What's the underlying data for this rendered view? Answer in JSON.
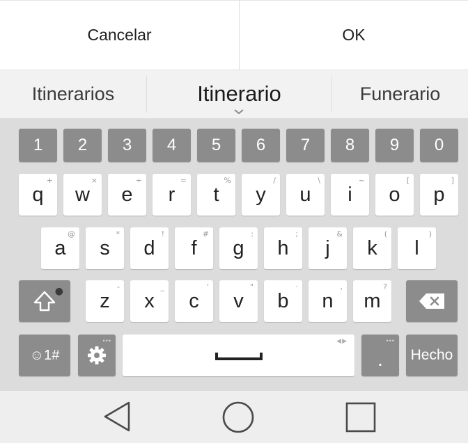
{
  "dialog": {
    "cancel_label": "Cancelar",
    "ok_label": "OK"
  },
  "suggestions": {
    "left": "Itinerarios",
    "center": "Itinerario",
    "right": "Funerario"
  },
  "keyboard": {
    "numbers": [
      "1",
      "2",
      "3",
      "4",
      "5",
      "6",
      "7",
      "8",
      "9",
      "0"
    ],
    "row_qwerty": [
      {
        "key": "q",
        "hint": "+"
      },
      {
        "key": "w",
        "hint": "×"
      },
      {
        "key": "e",
        "hint": "÷"
      },
      {
        "key": "r",
        "hint": "="
      },
      {
        "key": "t",
        "hint": "%"
      },
      {
        "key": "y",
        "hint": "/"
      },
      {
        "key": "u",
        "hint": "\\"
      },
      {
        "key": "i",
        "hint": "~"
      },
      {
        "key": "o",
        "hint": "["
      },
      {
        "key": "p",
        "hint": "]"
      }
    ],
    "row_asdf": [
      {
        "key": "a",
        "hint": "@"
      },
      {
        "key": "s",
        "hint": "*"
      },
      {
        "key": "d",
        "hint": "!"
      },
      {
        "key": "f",
        "hint": "#"
      },
      {
        "key": "g",
        "hint": ":"
      },
      {
        "key": "h",
        "hint": ";"
      },
      {
        "key": "j",
        "hint": "&"
      },
      {
        "key": "k",
        "hint": "("
      },
      {
        "key": "l",
        "hint": ")"
      }
    ],
    "row_zxcv": [
      {
        "key": "z",
        "hint": "-"
      },
      {
        "key": "x",
        "hint": "_"
      },
      {
        "key": "c",
        "hint": "'"
      },
      {
        "key": "v",
        "hint": "\""
      },
      {
        "key": "b",
        "hint": "·"
      },
      {
        "key": "n",
        "hint": ","
      },
      {
        "key": "m",
        "hint": "?"
      }
    ],
    "emoji_label": "☺1#",
    "period_label": ".",
    "done_label": "Hecho",
    "icons": {
      "shift": "shift-icon",
      "backspace": "backspace-icon",
      "settings": "gear-icon",
      "space": "space-icon"
    }
  },
  "navbar": {
    "icons": [
      "back-triangle-icon",
      "home-circle-icon",
      "recents-square-icon"
    ]
  },
  "colors": {
    "key_dark": "#8c8c8c",
    "key_light": "#ffffff",
    "keyboard_bg": "#dcdcdc"
  }
}
